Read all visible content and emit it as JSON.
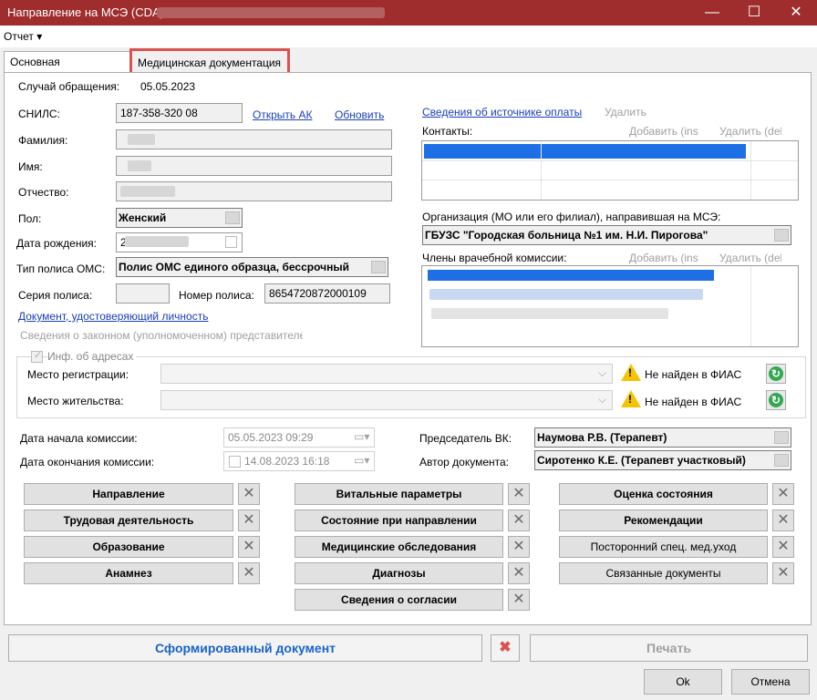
{
  "window": {
    "title": "Направление на МСЭ (CDA) -",
    "minimize": "—",
    "maximize": "☐",
    "close": "✕",
    "accent": "#9f2d2d"
  },
  "menu": {
    "report": "Отчет ▾"
  },
  "tabs": {
    "main": "Основная информация",
    "medical_docs": "Медицинская документация"
  },
  "case": {
    "label": "Случай обращения:",
    "value": "05.05.2023"
  },
  "patient": {
    "snils_label": "СНИЛС:",
    "snils_value": "187-358-320 08",
    "open_ak": "Открыть АК",
    "refresh": "Обновить",
    "surname_label": "Фамилия:",
    "name_label": "Имя:",
    "patronymic_label": "Отчество:",
    "sex_label": "Пол:",
    "sex_value": "Женский",
    "birth_label": "Дата рождения:",
    "birth_value": "2",
    "policy_type_label": "Тип полиса ОМС:",
    "policy_type_value": "Полис ОМС единого образца, бессрочный",
    "policy_series_label": "Серия полиса:",
    "policy_number_label": "Номер полиса:",
    "policy_number_value": "8654720872000109",
    "id_document_link": "Документ, удостоверяющий личность",
    "legal_rep": "Сведения о законном (уполномоченном) представителе"
  },
  "right": {
    "payment_link": "Сведения об источнике оплаты",
    "delete_payment": "Удалить",
    "contacts_label": "Контакты:",
    "contacts_add": "Добавить (ins",
    "contacts_delete": "Удалить (del",
    "org_label": "Организация (МО или его филиал), направившая на МСЭ:",
    "org_value": "ГБУЗС \"Городская больница №1 им. Н.И. Пирогова\"",
    "commission_label": "Члены врачебной комиссии:",
    "commission_add": "Добавить (ins",
    "commission_delete": "Удалить (del"
  },
  "addresses": {
    "group_label": "Инф. об адресах",
    "registration_label": "Место регистрации:",
    "residence_label": "Место жительства:",
    "not_found_1": "Не найден в ФИАС",
    "not_found_2": "Не найден в ФИАС"
  },
  "commission": {
    "start_label": "Дата начала комиссии:",
    "start_value": "05.05.2023 09:29",
    "end_label": "Дата окончания комиссии:",
    "end_value": "14.08.2023 16:18",
    "chair_label": "Председатель ВК:",
    "chair_value": "Наумова Р.В. (Терапевт)",
    "author_label": "Автор документа:",
    "author_value": "Сиротенко К.Е. (Терапевт участковый)"
  },
  "sections": {
    "col1": [
      "Направление",
      "Трудовая деятельность",
      "Образование",
      "Анамнез"
    ],
    "col2": [
      "Витальные параметры",
      "Состояние при направлении",
      "Медицинские обследования",
      "Диагнозы",
      "Сведения о согласии"
    ],
    "col3": [
      "Оценка состояния",
      "Рекомендации",
      "Посторонний спец. мед.уход",
      "Связанные документы"
    ]
  },
  "footer": {
    "formed_doc": "Сформированный документ",
    "print": "Печать",
    "ok": "Ok",
    "cancel": "Отмена"
  }
}
